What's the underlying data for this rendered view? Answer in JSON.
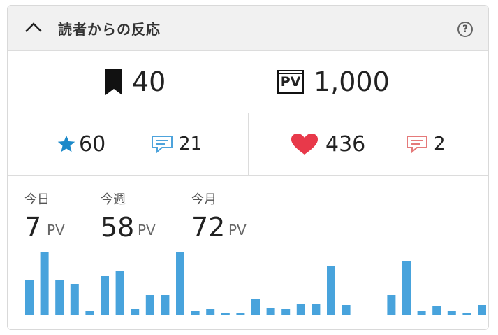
{
  "header": {
    "title": "読者からの反応",
    "help_label": "?"
  },
  "bookmarks": {
    "count": "40"
  },
  "pageviews": {
    "badge": "PV",
    "total": "1,000"
  },
  "left_group": {
    "stars": "60",
    "comments": "21"
  },
  "right_group": {
    "likes": "436",
    "comments": "2"
  },
  "stats": [
    {
      "label": "今日",
      "value": "7",
      "unit": "PV"
    },
    {
      "label": "今週",
      "value": "58",
      "unit": "PV"
    },
    {
      "label": "今月",
      "value": "72",
      "unit": "PV"
    }
  ],
  "colors": {
    "star": "#1b89c9",
    "chat_left": "#4da3dc",
    "heart": "#e8394a",
    "chat_right": "#e57a7a",
    "bar": "#48a3dc"
  },
  "chart_data": {
    "type": "bar",
    "values": [
      50,
      90,
      50,
      45,
      6,
      56,
      64,
      9,
      29,
      29,
      90,
      7,
      9,
      3,
      3,
      23,
      11,
      9,
      17,
      17,
      70,
      15,
      0,
      0,
      29,
      78,
      6,
      13,
      6,
      4,
      15
    ],
    "ylim": [
      0,
      90
    ]
  }
}
